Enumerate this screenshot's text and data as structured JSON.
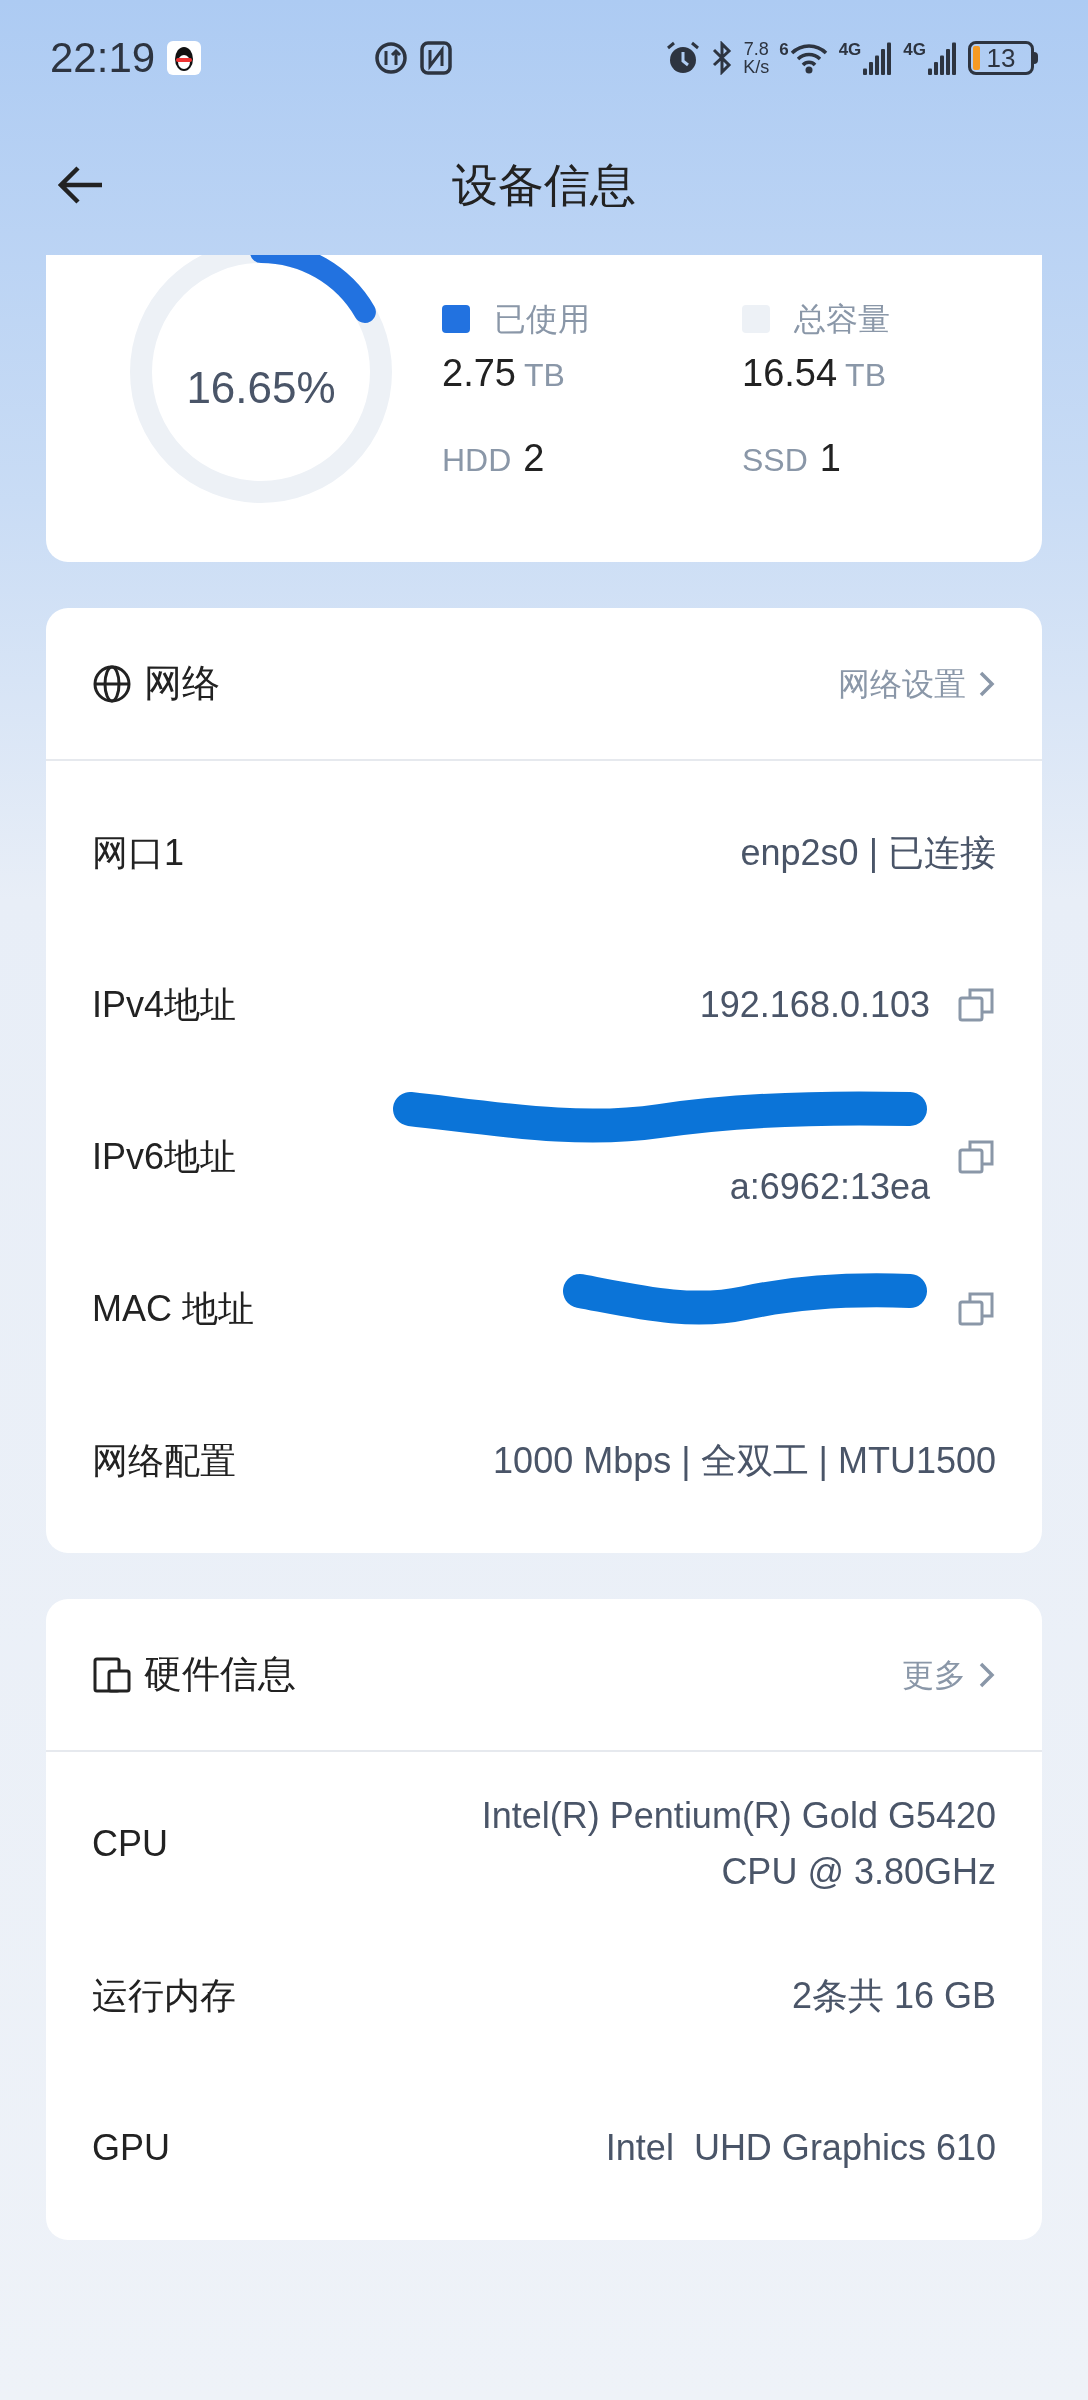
{
  "status_bar": {
    "time": "22:19",
    "speed_value": "7.8",
    "speed_unit": "K/s",
    "wifi_label": "6",
    "sim_labels": [
      "4G",
      "4G"
    ],
    "battery": "13"
  },
  "header": {
    "title": "设备信息"
  },
  "storage": {
    "percent": "16.65%",
    "level": 0.1665,
    "legend": [
      {
        "label": "已使用",
        "value": "2.75",
        "unit": "TB",
        "color": "#2272e0"
      },
      {
        "label": "总容量",
        "value": "16.54",
        "unit": "TB",
        "color": "#edf1f6"
      }
    ],
    "counts": [
      {
        "label": "HDD",
        "value": "2"
      },
      {
        "label": "SSD",
        "value": "1"
      }
    ]
  },
  "sections": [
    {
      "title": "网络",
      "link": "网络设置",
      "rows": [
        {
          "label": "网口1",
          "value": [
            "enp2s0 | 已连接"
          ],
          "copy": false,
          "redacted": false
        },
        {
          "label": "IPv4地址",
          "value": [
            "192.168.0.103"
          ],
          "copy": true,
          "redacted": false
        },
        {
          "label": "IPv6地址",
          "value": [
            "a:6962:13ea"
          ],
          "copy": true,
          "redacted": true
        },
        {
          "label": "MAC 地址",
          "value": [],
          "copy": true,
          "redacted": true
        },
        {
          "label": "网络配置",
          "value": [
            "1000 Mbps | 全双工 | MTU1500"
          ],
          "copy": false,
          "redacted": false
        }
      ]
    },
    {
      "title": "硬件信息",
      "link": "更多",
      "rows": [
        {
          "label": "CPU",
          "value": [
            "Intel(R) Pentium(R) Gold G5420",
            "CPU @ 3.80GHz"
          ],
          "copy": false,
          "redacted": false
        },
        {
          "label": "运行内存",
          "value": [
            "2条共 16 GB"
          ],
          "copy": false,
          "redacted": false
        },
        {
          "label": "GPU",
          "value": [
            "Intel  UHD Graphics 610"
          ],
          "copy": false,
          "redacted": false
        }
      ]
    }
  ]
}
